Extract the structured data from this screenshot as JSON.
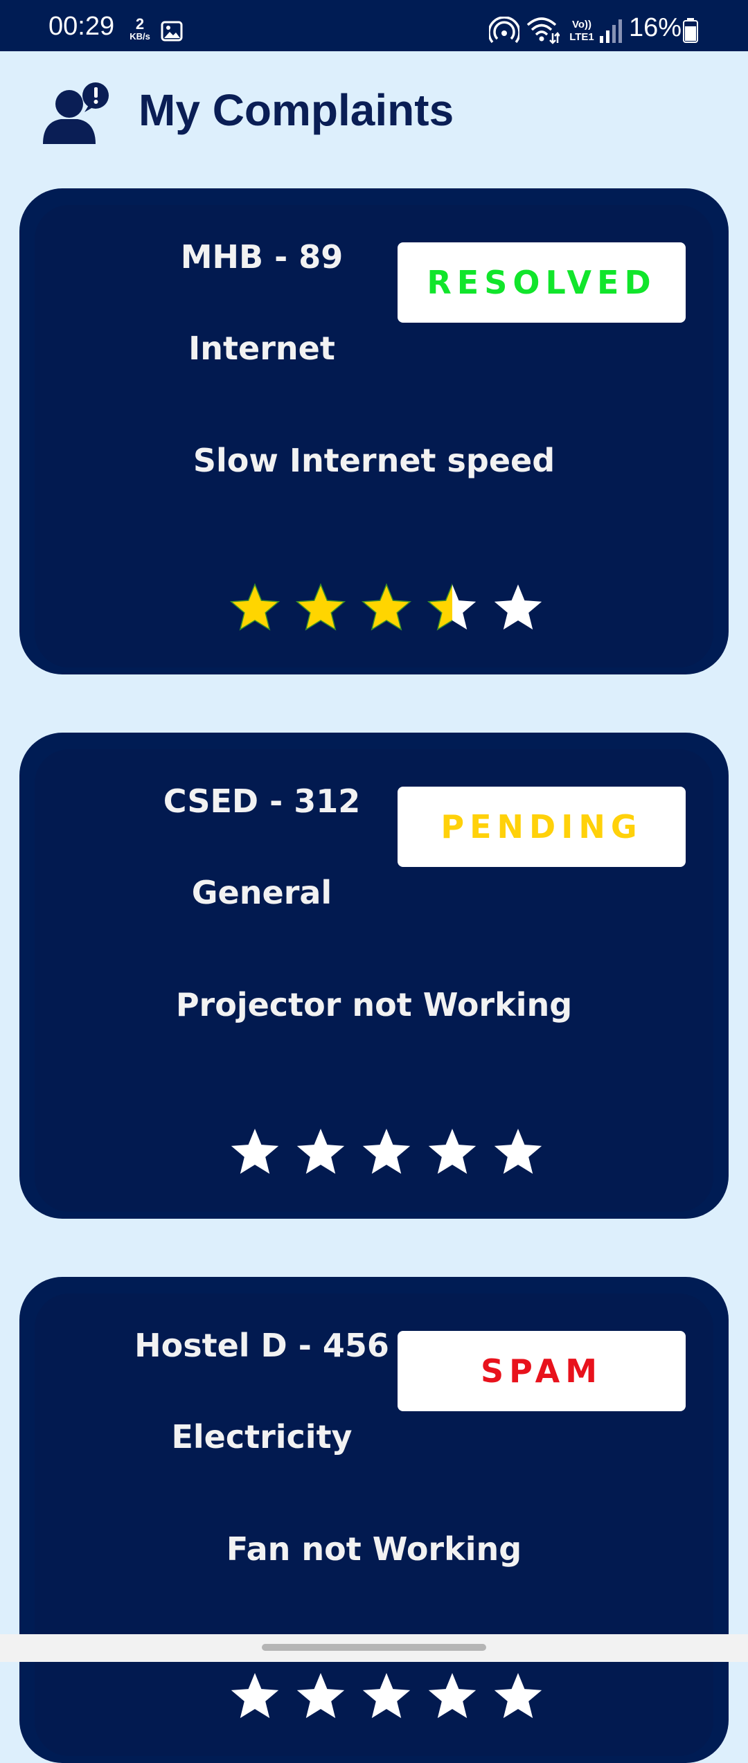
{
  "status_bar": {
    "time": "00:29",
    "net_speed_value": "2",
    "net_speed_unit": "KB/s",
    "battery": "16%",
    "lte_label": "LTE1",
    "volte_label": "Vo))"
  },
  "header": {
    "title": "My Complaints",
    "icon": "user-alert-icon"
  },
  "colors": {
    "background": "#DDEFFC",
    "card": "#001C54",
    "resolved": "#11E52B",
    "pending": "#FFD10A",
    "spam": "#E8121C",
    "star_filled": "#FFD500",
    "star_empty": "#FFFFFF"
  },
  "complaints": [
    {
      "code": "MHB - 89",
      "status": "RESOLVED",
      "status_color": "#11E52B",
      "category": "Internet",
      "description": "Slow Internet speed",
      "rating": 3.5,
      "max_rating": 5
    },
    {
      "code": "CSED - 312",
      "status": "PENDING",
      "status_color": "#FFD10A",
      "category": "General",
      "description": "Projector not Working",
      "rating": 0,
      "max_rating": 5
    },
    {
      "code": "Hostel D - 456",
      "status": "SPAM",
      "status_color": "#E8121C",
      "category": "Electricity",
      "description": "Fan not Working",
      "rating": 0,
      "max_rating": 5
    }
  ]
}
